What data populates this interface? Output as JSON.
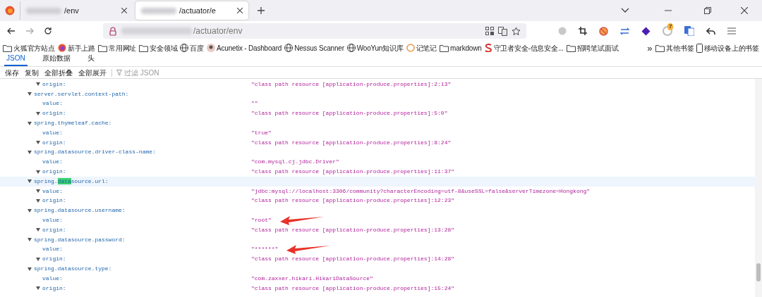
{
  "browser_tabs": [
    {
      "title": "/env",
      "selected": false
    },
    {
      "title": "/actuator/e",
      "selected": true
    }
  ],
  "address_bar": {
    "url": "/actuator/env"
  },
  "toolbar_badge": "7",
  "bookmarks": [
    {
      "label": "火狐官方站点",
      "kind": "folder"
    },
    {
      "label": "新手上路",
      "kind": "firefox"
    },
    {
      "label": "常用网址",
      "kind": "folder"
    },
    {
      "label": "安全领域",
      "kind": "folder"
    },
    {
      "label": "百度",
      "kind": "globe"
    },
    {
      "label": "Acunetix - Dashboard",
      "kind": "avatar"
    },
    {
      "label": "Nessus Scanner",
      "kind": "globe"
    },
    {
      "label": "WooYun知识库",
      "kind": "globe"
    },
    {
      "label": "记笔记",
      "kind": "ring"
    },
    {
      "label": "markdown",
      "kind": "folder"
    },
    {
      "label": "守卫者安全-信息安全...",
      "kind": "shield"
    },
    {
      "label": "招聘笔试面试",
      "kind": "folder"
    }
  ],
  "bookmarks_overflow": "»",
  "bookmarks_right": [
    {
      "label": "其他书签",
      "kind": "folder"
    },
    {
      "label": "移动设备上的书签",
      "kind": "phone"
    }
  ],
  "viewer_tabs": [
    {
      "label": "JSON",
      "selected": true
    },
    {
      "label": "原始数据",
      "selected": false
    },
    {
      "label": "头",
      "selected": false
    }
  ],
  "viewer_toolbar": {
    "buttons": [
      "保存",
      "复制",
      "全部折叠",
      "全部展开"
    ],
    "filter_placeholder": "过滤 JSON"
  },
  "properties": [
    {
      "selected": false,
      "children": [
        {
          "key": "origin:",
          "toggle": true,
          "text": "\"class path resource [application-produce.properties]:2:13\"",
          "annotated": false
        }
      ]
    },
    {
      "key_parts": [
        {
          "text": "server.servlet.context-path:",
          "highlighted": false
        }
      ],
      "selected": false,
      "children": [
        {
          "key": "value:",
          "toggle": false,
          "text": "\"\"",
          "annotated": false
        },
        {
          "key": "origin:",
          "toggle": true,
          "text": "\"class path resource [application-produce.properties]:5:0\"",
          "annotated": false
        }
      ]
    },
    {
      "key_parts": [
        {
          "text": "spring.thymeleaf.cache:",
          "highlighted": false
        }
      ],
      "selected": false,
      "children": [
        {
          "key": "value:",
          "toggle": false,
          "text": "\"true\"",
          "annotated": false
        },
        {
          "key": "origin:",
          "toggle": true,
          "text": "\"class path resource [application-produce.properties]:8:24\"",
          "annotated": false
        }
      ]
    },
    {
      "key_parts": [
        {
          "text": "spring.datasource.driver-class-name:",
          "highlighted": false
        }
      ],
      "selected": false,
      "children": [
        {
          "key": "value:",
          "toggle": false,
          "text": "\"com.mysql.cj.jdbc.Driver\"",
          "annotated": false
        },
        {
          "key": "origin:",
          "toggle": true,
          "text": "\"class path resource [application-produce.properties]:11:37\"",
          "annotated": false
        }
      ]
    },
    {
      "key_parts": [
        {
          "text": "spring.",
          "highlighted": false
        },
        {
          "text": "data",
          "highlighted": true
        },
        {
          "text": "source.url:",
          "highlighted": false
        }
      ],
      "selected": true,
      "children": [
        {
          "key": "value:",
          "toggle": true,
          "text": "\"jdbc:mysql://localhost:3306/community?characterEncoding=utf-8&useSSL=false&serverTimezone=Hongkong\"",
          "annotated": false
        },
        {
          "key": "origin:",
          "toggle": true,
          "text": "\"class path resource [application-produce.properties]:12:23\"",
          "annotated": false
        }
      ]
    },
    {
      "key_parts": [
        {
          "text": "spring.datasource.username:",
          "highlighted": false
        }
      ],
      "selected": false,
      "children": [
        {
          "key": "value:",
          "toggle": false,
          "text": "\"root\"",
          "annotated": true
        },
        {
          "key": "origin:",
          "toggle": true,
          "text": "\"class path resource [application-produce.properties]:13:28\"",
          "annotated": false
        }
      ]
    },
    {
      "key_parts": [
        {
          "text": "spring.datasource.password:",
          "highlighted": false
        }
      ],
      "selected": false,
      "children": [
        {
          "key": "value:",
          "toggle": false,
          "text": "\"******\"",
          "annotated": true
        },
        {
          "key": "origin:",
          "toggle": true,
          "text": "\"class path resource [application-produce.properties]:14:28\"",
          "annotated": false
        }
      ]
    },
    {
      "key_parts": [
        {
          "text": "spring.datasource.type:",
          "highlighted": false
        }
      ],
      "selected": false,
      "children": [
        {
          "key": "value:",
          "toggle": false,
          "text": "\"com.zaxxer.hikari.HikariDataSource\"",
          "annotated": false
        },
        {
          "key": "origin:",
          "toggle": true,
          "text": "\"class path resource [application-produce.properties]:15:24\"",
          "annotated": false
        }
      ]
    }
  ]
}
